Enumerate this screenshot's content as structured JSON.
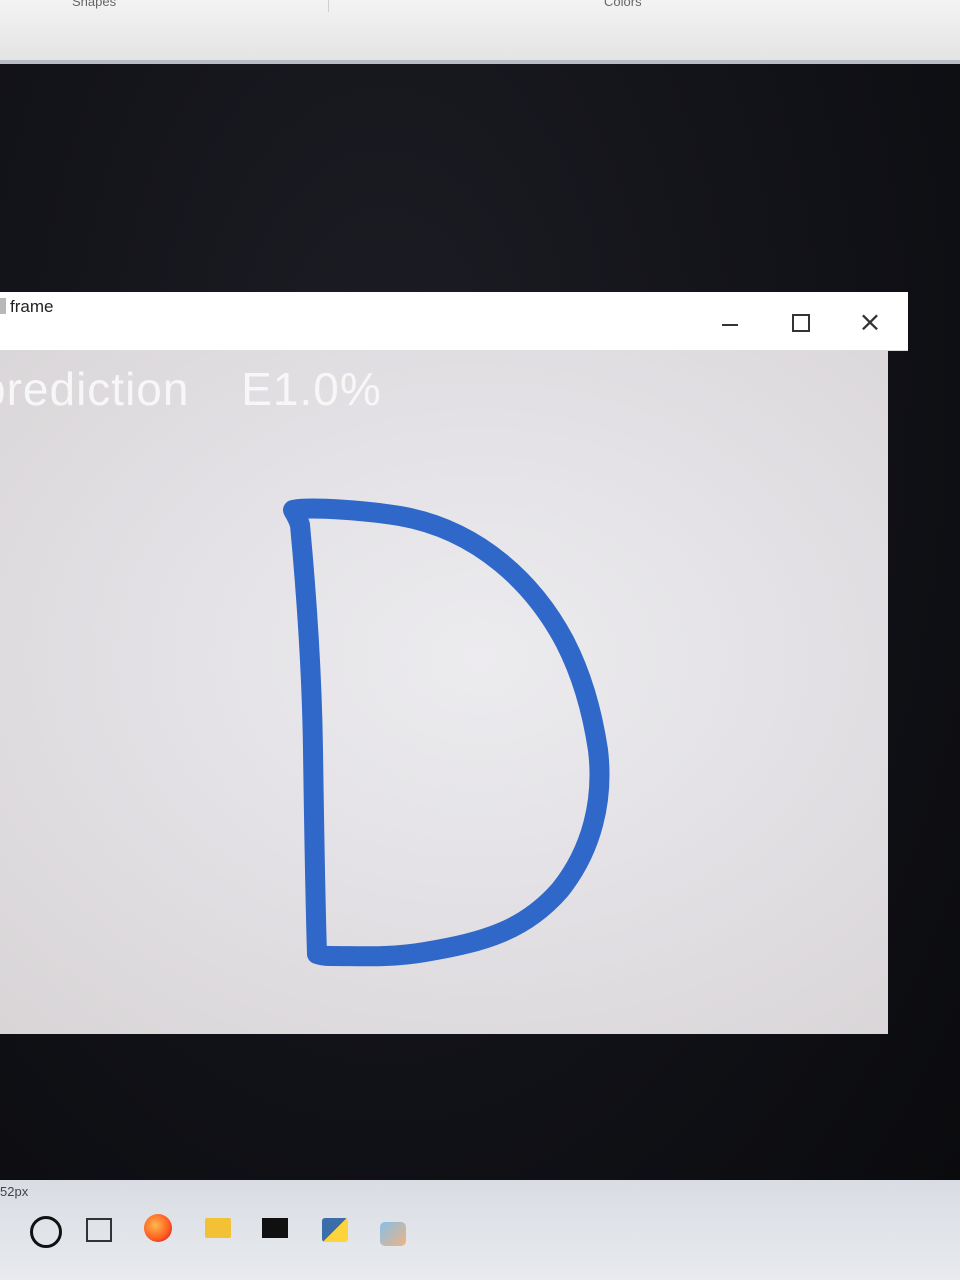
{
  "paint_ribbon": {
    "shapes_label": "Shapes",
    "colors_label": "Colors"
  },
  "frame_window": {
    "title": "frame",
    "icon": "window-icon",
    "controls": {
      "minimize_icon": "minimize-icon",
      "maximize_icon": "maximize-icon",
      "close_icon": "close-icon",
      "close_glyph": "×"
    }
  },
  "canvas": {
    "prediction_label": "prediction",
    "prediction_value": "E1.0%",
    "drawn_letter": "D",
    "stroke_color": "#2f68c8",
    "background_color": "#e7e5e8",
    "text_color": "#f7f7f7"
  },
  "taskbar": {
    "size_text": "52px",
    "icons": [
      "search-icon",
      "task-view-icon",
      "firefox-icon",
      "file-manager-icon",
      "terminal-icon",
      "python-icon",
      "paint-icon"
    ]
  }
}
